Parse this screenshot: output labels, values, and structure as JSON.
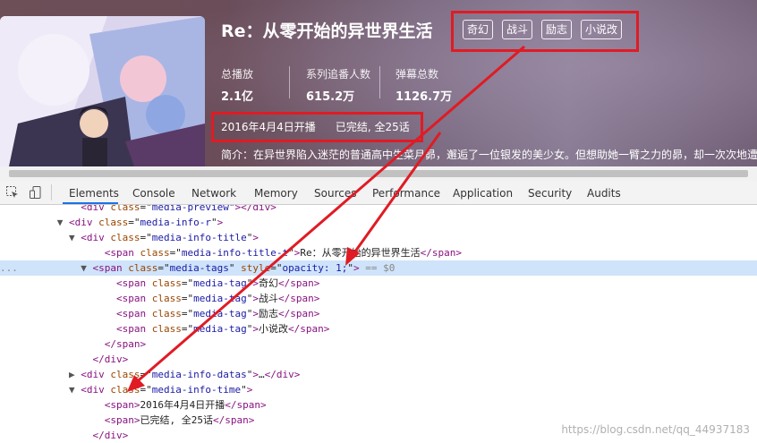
{
  "media": {
    "title": "Re：从零开始的异世界生活",
    "tags": [
      "奇幻",
      "战斗",
      "励志",
      "小说改"
    ],
    "stats": [
      {
        "label": "总播放",
        "value": "2.1亿"
      },
      {
        "label": "系列追番人数",
        "value": "615.2万"
      },
      {
        "label": "弹幕总数",
        "value": "1126.7万"
      }
    ],
    "pub_date": "2016年4月4日开播",
    "status": "已完结, 全25话",
    "intro": "简介：在异世界陷入迷茫的普通高中生菜月昴，邂逅了一位银发的美少女。但想助她一臂之力的昴，却一次次地遭"
  },
  "devtools": {
    "tabs": [
      "Elements",
      "Console",
      "Network",
      "Memory",
      "Sources",
      "Performance",
      "Application",
      "Security",
      "Audits"
    ],
    "active_tab": "Elements",
    "icons": [
      "inspect-icon",
      "device-toggle-icon"
    ],
    "lines": [
      {
        "pre": "        ",
        "arrow": "",
        "tag": "div",
        "attrs": [
          [
            "class",
            "media-preview"
          ]
        ],
        "text": "",
        "close": "div",
        "suffix": "",
        "dim": true
      },
      {
        "pre": "      ",
        "arrow": "▼",
        "tag": "div",
        "attrs": [
          [
            "class",
            "media-info-r"
          ]
        ],
        "text": "",
        "close": "",
        "suffix": ""
      },
      {
        "pre": "        ",
        "arrow": "▼",
        "tag": "div",
        "attrs": [
          [
            "class",
            "media-info-title"
          ]
        ],
        "text": "",
        "close": "",
        "suffix": ""
      },
      {
        "pre": "            ",
        "arrow": "",
        "tag": "span",
        "attrs": [
          [
            "class",
            "media-info-title-t"
          ]
        ],
        "text": "Re：从零开始的异世界生活",
        "close": "span",
        "suffix": ""
      },
      {
        "pre": "          ",
        "arrow": "▼",
        "tag": "span",
        "attrs": [
          [
            "class",
            "media-tags"
          ],
          [
            "style",
            "opacity: 1;"
          ]
        ],
        "text": "",
        "close": "",
        "suffix": " == $0",
        "selected": true
      },
      {
        "pre": "              ",
        "arrow": "",
        "tag": "span",
        "attrs": [
          [
            "class",
            "media-tag"
          ]
        ],
        "text": "奇幻",
        "close": "span",
        "suffix": ""
      },
      {
        "pre": "              ",
        "arrow": "",
        "tag": "span",
        "attrs": [
          [
            "class",
            "media-tag"
          ]
        ],
        "text": "战斗",
        "close": "span",
        "suffix": ""
      },
      {
        "pre": "              ",
        "arrow": "",
        "tag": "span",
        "attrs": [
          [
            "class",
            "media-tag"
          ]
        ],
        "text": "励志",
        "close": "span",
        "suffix": ""
      },
      {
        "pre": "              ",
        "arrow": "",
        "tag": "span",
        "attrs": [
          [
            "class",
            "media-tag"
          ]
        ],
        "text": "小说改",
        "close": "span",
        "suffix": ""
      },
      {
        "pre": "            ",
        "arrow": "",
        "tag": "",
        "attrs": [],
        "text": "",
        "close": "span",
        "suffix": ""
      },
      {
        "pre": "          ",
        "arrow": "",
        "tag": "",
        "attrs": [],
        "text": "",
        "close": "div",
        "suffix": ""
      },
      {
        "pre": "        ",
        "arrow": "▶",
        "tag": "div",
        "attrs": [
          [
            "class",
            "media-info-datas"
          ]
        ],
        "text": "…",
        "close": "div",
        "suffix": ""
      },
      {
        "pre": "        ",
        "arrow": "▼",
        "tag": "div",
        "attrs": [
          [
            "class",
            "media-info-time"
          ]
        ],
        "text": "",
        "close": "",
        "suffix": ""
      },
      {
        "pre": "            ",
        "arrow": "",
        "tag": "span",
        "attrs": [],
        "text": "2016年4月4日开播",
        "close": "span",
        "suffix": ""
      },
      {
        "pre": "            ",
        "arrow": "",
        "tag": "span",
        "attrs": [],
        "text": "已完结, 全25话",
        "close": "span",
        "suffix": ""
      },
      {
        "pre": "          ",
        "arrow": "",
        "tag": "",
        "attrs": [],
        "text": "",
        "close": "div",
        "suffix": ""
      }
    ],
    "ellipsis": "..."
  },
  "watermark": "https://blog.csdn.net/qq_44937183",
  "colors": {
    "annotation_red": "#e01b24",
    "selected_row": "#cfe3fa",
    "tag_name": "#881280",
    "attr_name": "#994500",
    "attr_value": "#1a1aa6"
  }
}
